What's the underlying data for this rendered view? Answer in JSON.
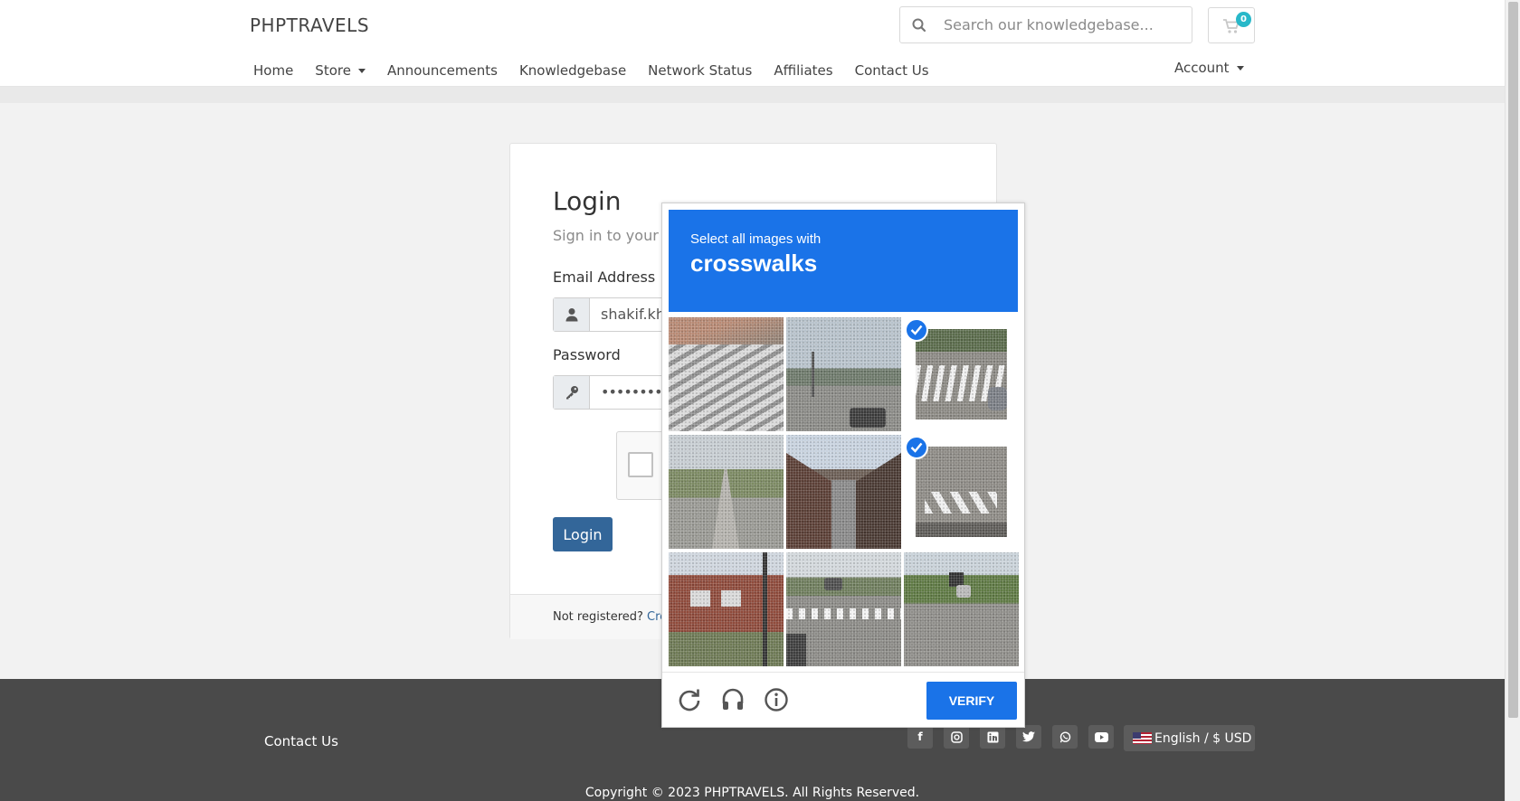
{
  "header": {
    "brand": "PHPTRAVELS",
    "search_placeholder": "Search our knowledgebase...",
    "cart_count": "0",
    "nav": [
      "Home",
      "Store",
      "Announcements",
      "Knowledgebase",
      "Network Status",
      "Affiliates",
      "Contact Us"
    ],
    "account": "Account"
  },
  "login": {
    "title": "Login",
    "subtitle": "Sign in to your a",
    "email_label": "Email Address",
    "email_value": "shakif.kh",
    "password_label": "Password",
    "password_value": "••••••••••",
    "button": "Login",
    "not_registered": "Not registered?",
    "create_link": "Crea"
  },
  "captcha": {
    "instruction": "Select all images with",
    "target": "crosswalks",
    "verify_label": "VERIFY",
    "tiles": [
      {
        "scene": "crosswalk-closeup",
        "selected": false
      },
      {
        "scene": "road-car",
        "selected": false
      },
      {
        "scene": "crosswalk-intersection",
        "selected": true
      },
      {
        "scene": "road-trees",
        "selected": false
      },
      {
        "scene": "houses-alley",
        "selected": false
      },
      {
        "scene": "crosswalk-road",
        "selected": true
      },
      {
        "scene": "brick-house",
        "selected": false
      },
      {
        "scene": "street-crosswalk",
        "selected": false
      },
      {
        "scene": "road-traffic",
        "selected": false
      }
    ],
    "icons": [
      "reload-icon",
      "audio-icon",
      "info-icon"
    ]
  },
  "footer": {
    "contact": "Contact Us",
    "socials": [
      "facebook-icon",
      "instagram-icon",
      "linkedin-icon",
      "twitter-icon",
      "whatsapp-icon",
      "youtube-icon"
    ],
    "language": "English / $ USD",
    "copyright": "Copyright © 2023 PHPTRAVELS. All Rights Reserved."
  },
  "colors": {
    "captcha_blue": "#1a73e8",
    "login_button": "#336699",
    "footer_bg": "#4a4a4a",
    "cart_badge": "#28b8c9"
  }
}
